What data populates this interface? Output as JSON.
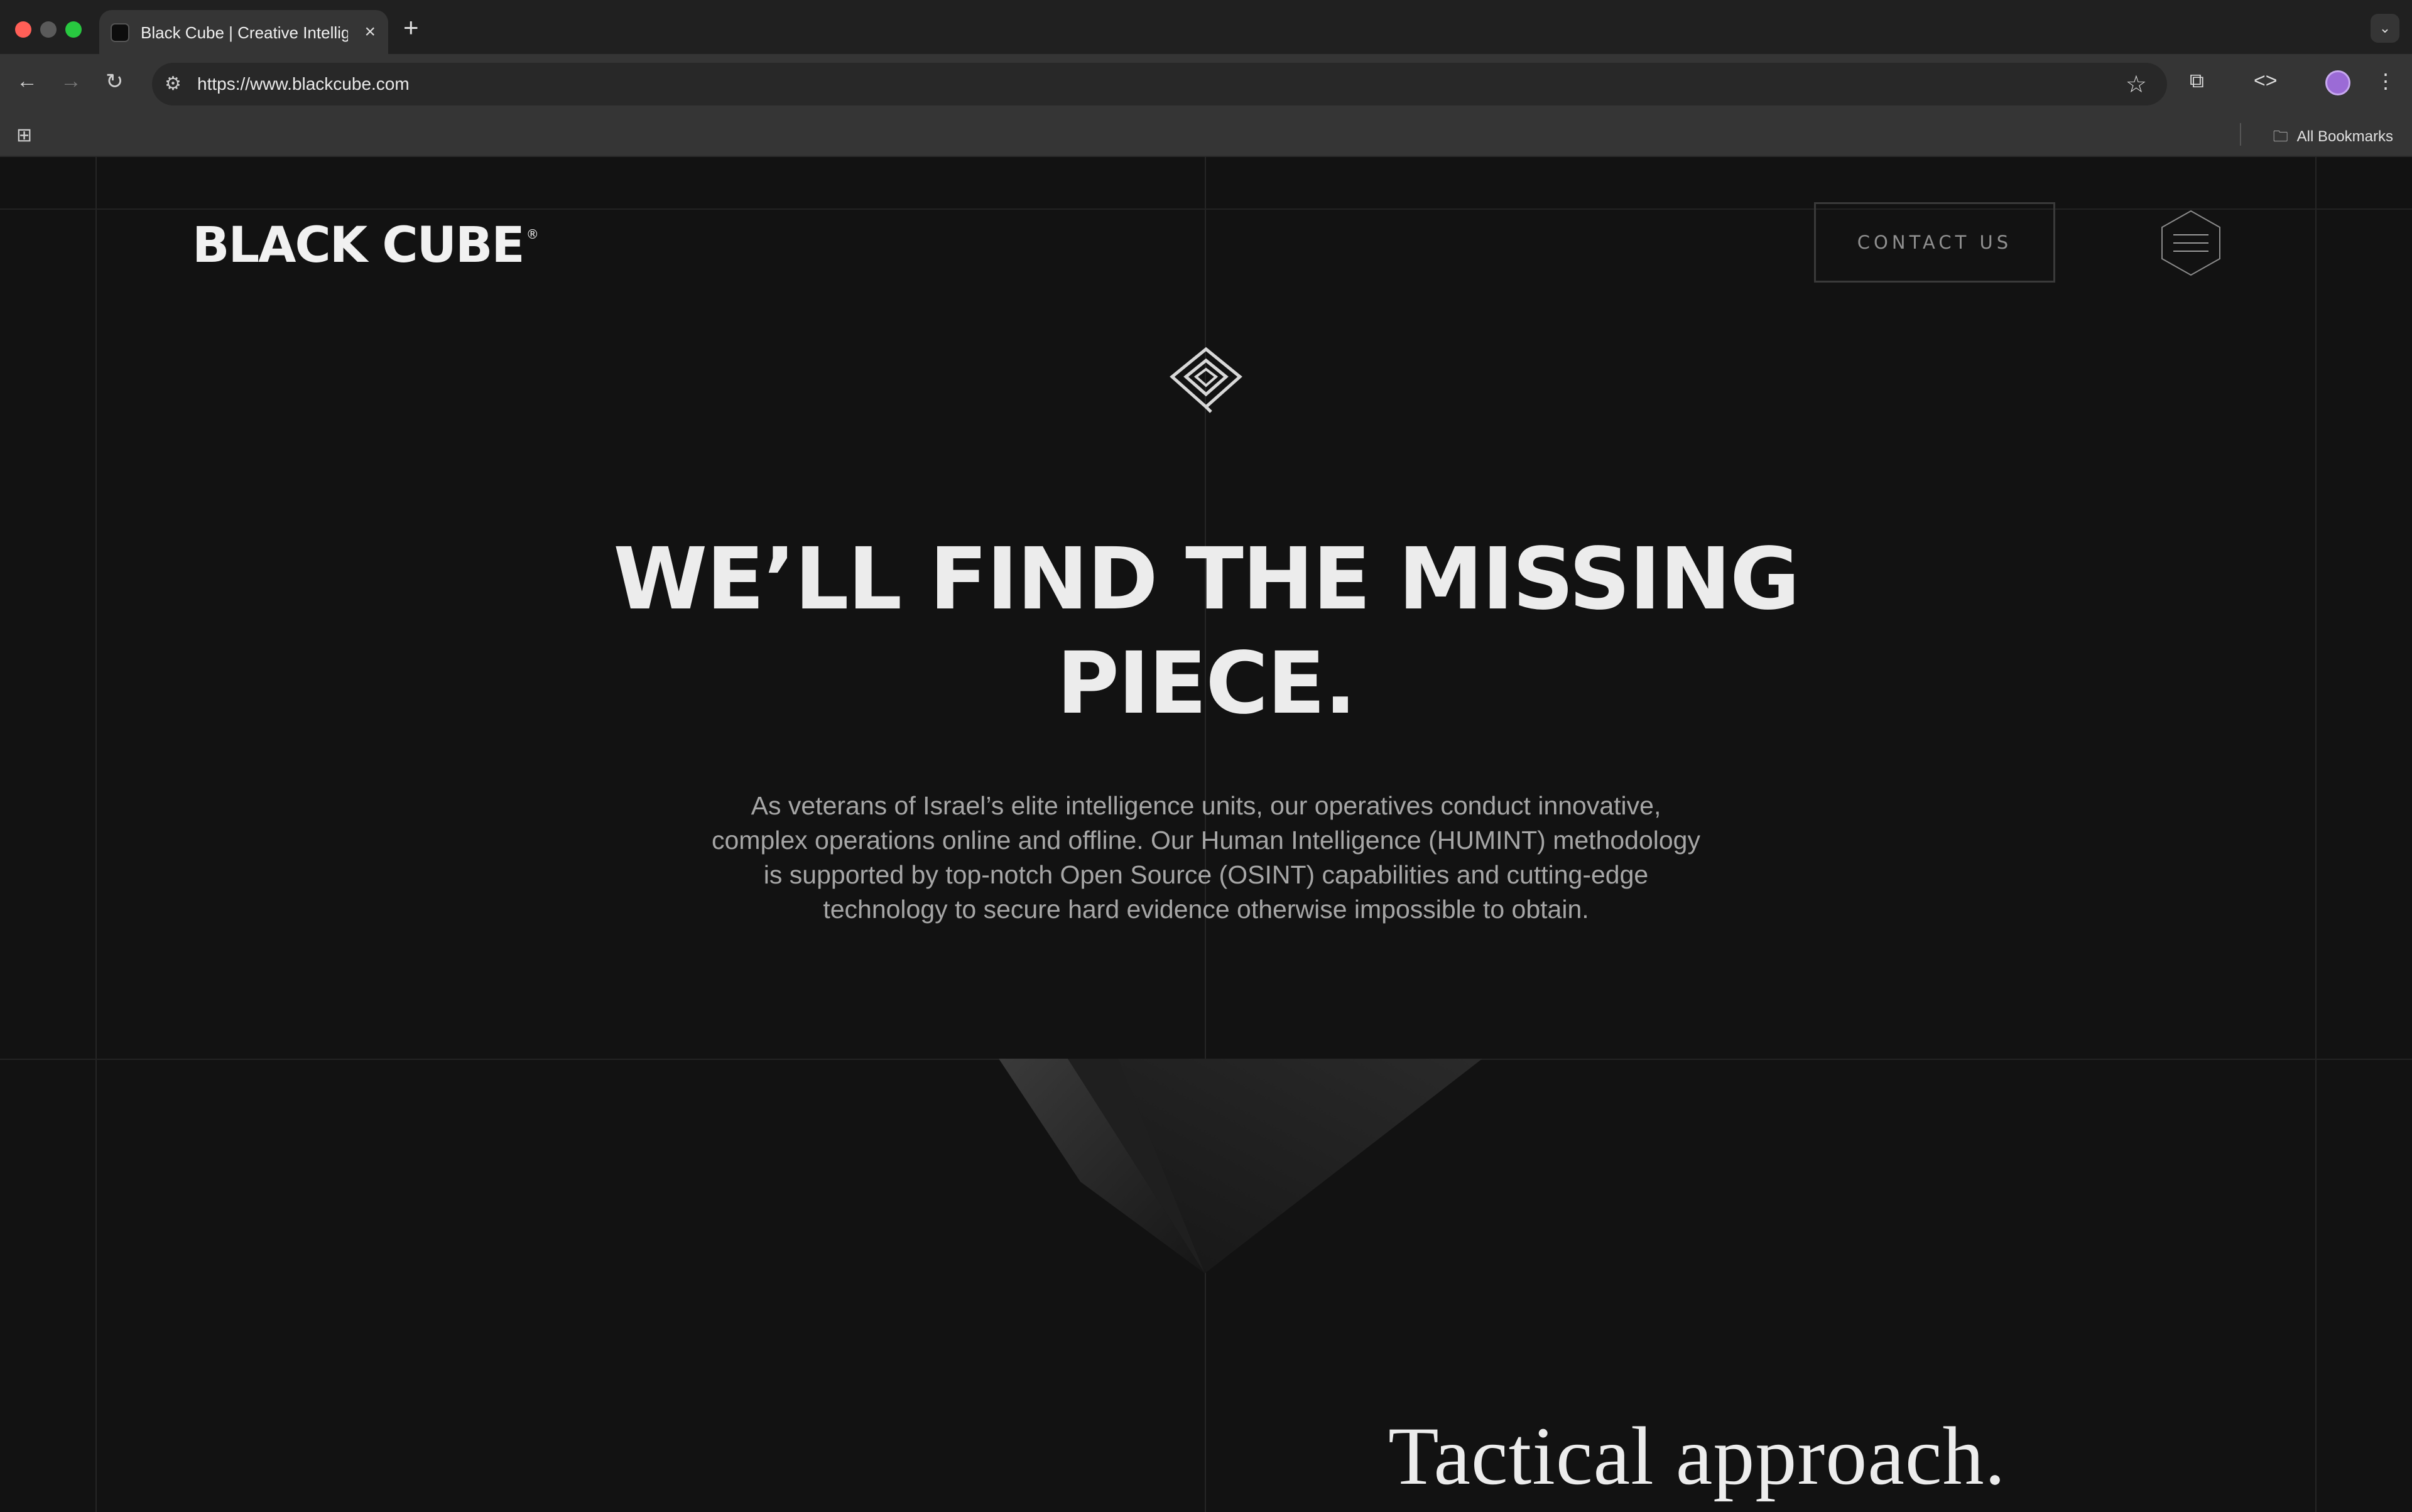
{
  "browser": {
    "tab_title": "Black Cube | Creative Intellige",
    "tab_close": "×",
    "new_tab": "+",
    "url": "https://www.blackcube.com",
    "bookmarks_label": "All Bookmarks"
  },
  "site": {
    "logo_text": "BLACK CUBE",
    "logo_mark": "®",
    "contact_label": "CONTACT US",
    "headline": "WE’LL FIND THE MISSING PIECE.",
    "intro": "As veterans of Israel’s elite intelligence units, our operatives conduct innovative, complex operations online and offline. Our Human Intelligence (HUMINT) methodology is supported by top-notch Open Source (OSINT) capabilities and cutting-edge technology to secure hard evidence otherwise impossible to obtain.",
    "section_heading": "Tactical approach."
  },
  "colors": {
    "background": "#121212",
    "text": "#ececec",
    "muted_text": "#a6a6a6",
    "accent_profile": "#9b6bd6"
  },
  "icons": [
    "back-icon",
    "forward-icon",
    "reload-icon",
    "site-info-icon",
    "star-icon",
    "extensions-icon",
    "code-icon",
    "kebab-menu-icon",
    "apps-grid-icon",
    "folder-icon",
    "hexagon-menu-icon",
    "diamond-logo-icon"
  ]
}
